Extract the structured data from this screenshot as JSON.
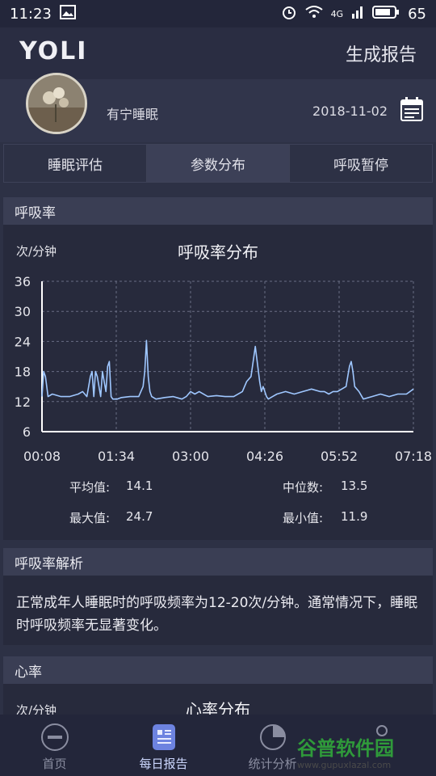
{
  "status_bar": {
    "time": "11:23",
    "network": "4G",
    "battery": "65"
  },
  "header": {
    "logo": "YOLI",
    "generate_report": "生成报告"
  },
  "profile": {
    "name": "有宁睡眠",
    "date": "2018-11-02"
  },
  "tabs": [
    {
      "label": "睡眠评估"
    },
    {
      "label": "参数分布"
    },
    {
      "label": "呼吸暂停"
    }
  ],
  "resp_section": {
    "title": "呼吸率"
  },
  "chart_data": {
    "type": "line",
    "title": "呼吸率分布",
    "ylabel": "次/分钟",
    "yticks": [
      "36",
      "30",
      "24",
      "18",
      "12",
      "6"
    ],
    "xticks": [
      "00:08",
      "01:34",
      "03:00",
      "04:26",
      "05:52",
      "07:18"
    ],
    "ylim": [
      6,
      36
    ],
    "grid": true,
    "x_range_minutes": [
      8,
      438
    ],
    "series": [
      {
        "color": "#9fc7ff",
        "x": [
          8,
          10,
          12,
          15,
          20,
          30,
          40,
          50,
          55,
          60,
          62,
          64,
          66,
          68,
          70,
          72,
          74,
          76,
          78,
          80,
          82,
          84,
          86,
          88,
          90,
          95,
          100,
          110,
          120,
          125,
          127,
          129,
          131,
          133,
          135,
          140,
          150,
          160,
          170,
          175,
          180,
          185,
          190,
          200,
          210,
          220,
          230,
          240,
          245,
          250,
          255,
          260,
          262,
          264,
          266,
          268,
          270,
          275,
          280,
          290,
          300,
          310,
          320,
          330,
          335,
          340,
          345,
          350,
          355,
          360,
          362,
          364,
          366,
          368,
          370,
          375,
          380,
          390,
          400,
          410,
          420,
          430,
          438
        ],
        "values": [
          13,
          18,
          17,
          13,
          13.5,
          13,
          13,
          13.5,
          14,
          13,
          15,
          17,
          18,
          13,
          18,
          17,
          15,
          13,
          18,
          16,
          14,
          19,
          20,
          13,
          12.5,
          12.5,
          12.8,
          13,
          13,
          15,
          18,
          24.2,
          17,
          14,
          13,
          12.5,
          12.8,
          13,
          12.5,
          13,
          14,
          13.5,
          14,
          13,
          13.2,
          13,
          13,
          14,
          16,
          17,
          23,
          16,
          14,
          15,
          14,
          13,
          12.5,
          13,
          13.5,
          14,
          13.5,
          14,
          14.5,
          14,
          14,
          13.5,
          14,
          14,
          14.5,
          15,
          17,
          19,
          20,
          18,
          15,
          14,
          12.5,
          13,
          13.5,
          13,
          13.5,
          13.5,
          14.5
        ]
      }
    ]
  },
  "stats": {
    "avg_label": "平均值:",
    "avg_value": "14.1",
    "median_label": "中位数:",
    "median_value": "13.5",
    "max_label": "最大值:",
    "max_value": "24.7",
    "min_label": "最小值:",
    "min_value": "11.9"
  },
  "analysis": {
    "title": "呼吸率解析",
    "text": "正常成年人睡眠时的呼吸频率为12-20次/分钟。通常情况下，睡眠时呼吸频率无显著变化。"
  },
  "heart_section": {
    "title": "心率",
    "unit": "次/分钟",
    "chart_title": "心率分布"
  },
  "bottom_nav": [
    {
      "label": "首页",
      "icon": "yoli-home-icon"
    },
    {
      "label": "每日报告",
      "icon": "report-icon"
    },
    {
      "label": "统计分析",
      "icon": "pie-chart-icon"
    }
  ],
  "watermark": {
    "title": "谷普软件园",
    "url": "www.gupuxlazal.com"
  }
}
